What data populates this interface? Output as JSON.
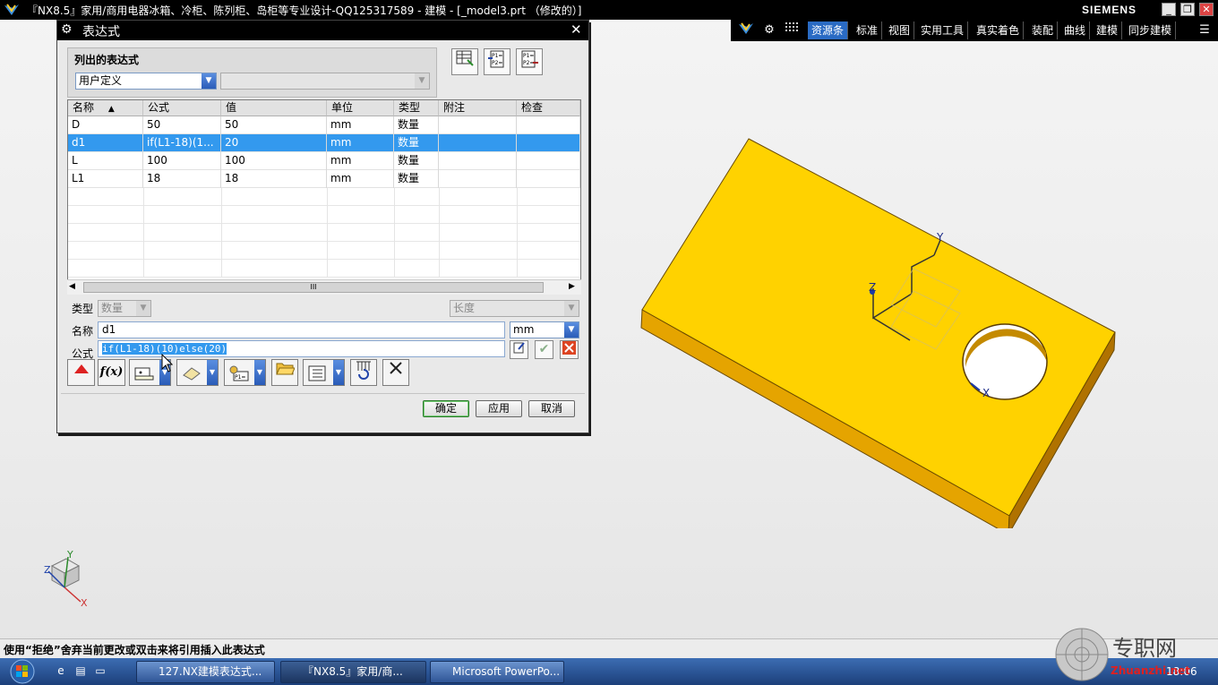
{
  "window": {
    "title": "『NX8.5』家用/商用电器冰箱、冷柜、陈列柜、岛柜等专业设计-QQ125317589 - 建模 - [_model3.prt （修改的）]",
    "brand": "SIEMENS",
    "minimize_label": "_",
    "restore_label": "❐",
    "close_label": "✕"
  },
  "toolbar": {
    "items": [
      "资源条",
      "标准",
      "视图",
      "实用工具",
      "真实着色",
      "装配",
      "曲线",
      "建模",
      "同步建模"
    ],
    "active_item": "资源条",
    "icons": {
      "nx_logo": "nx-logo-icon",
      "settings": "gear-icon",
      "grid": "grid-icon",
      "menu": "menu-icon"
    }
  },
  "dialog": {
    "title": "表达式",
    "close_label": "✕",
    "listed_group": {
      "label": "列出的表达式",
      "filter_value": "用户定义",
      "secondary_value": ""
    },
    "table": {
      "columns": [
        "名称",
        "公式",
        "值",
        "单位",
        "类型",
        "附注",
        "检查"
      ],
      "sort_indicator": "▲",
      "rows": [
        {
          "name": "D",
          "formula": "50",
          "value": "50",
          "unit": "mm",
          "type": "数量",
          "note": "",
          "check": ""
        },
        {
          "name": "d1",
          "formula": "if(L1-18)(1...",
          "value": "20",
          "unit": "mm",
          "type": "数量",
          "note": "",
          "check": ""
        },
        {
          "name": "L",
          "formula": "100",
          "value": "100",
          "unit": "mm",
          "type": "数量",
          "note": "",
          "check": ""
        },
        {
          "name": "L1",
          "formula": "18",
          "value": "18",
          "unit": "mm",
          "type": "数量",
          "note": "",
          "check": ""
        }
      ],
      "selected_row": 1,
      "scroll_thumb": "III"
    },
    "type_label": "类型",
    "type_value": "数量",
    "dimension_value": "长度",
    "name_label": "名称",
    "name_value": "d1",
    "unit_value": "mm",
    "formula_label": "公式",
    "formula_value": "if(L1-18)(10)else(20)",
    "buttons": {
      "ok": "确定",
      "apply": "应用",
      "cancel": "取消"
    }
  },
  "viewport": {
    "model_color": "#ffd700",
    "model_side_color": "#c88a00",
    "axis_labels": {
      "x": "X",
      "y": "Y",
      "z": "Z"
    }
  },
  "statusbar": {
    "text": "使用“拒绝”舍弃当前更改或双击来将引用插入此表达式"
  },
  "taskbar": {
    "tasks": [
      "127.NX建模表达式...",
      "『NX8.5』家用/商...",
      "Microsoft PowerPo..."
    ],
    "active_task": 1,
    "clock": "18:06"
  },
  "watermark": {
    "text": "专职网",
    "url": "Zhuanzhi.net"
  }
}
